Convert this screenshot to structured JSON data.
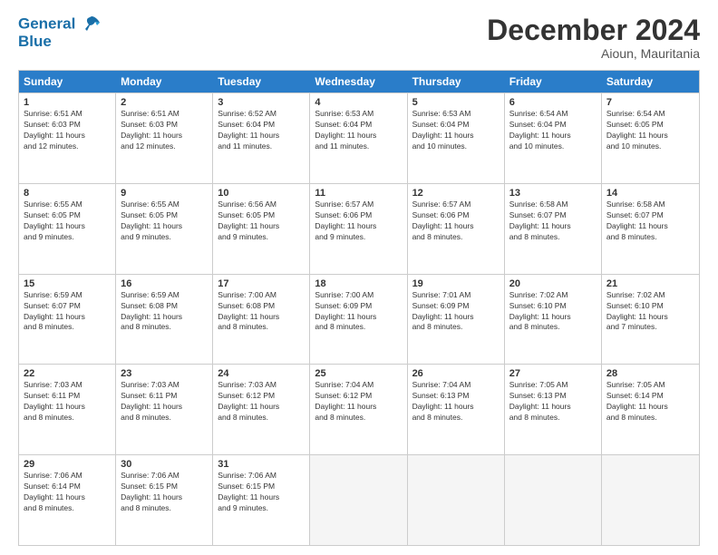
{
  "header": {
    "logo_line1": "General",
    "logo_line2": "Blue",
    "month": "December 2024",
    "location": "Aioun, Mauritania"
  },
  "weekdays": [
    "Sunday",
    "Monday",
    "Tuesday",
    "Wednesday",
    "Thursday",
    "Friday",
    "Saturday"
  ],
  "rows": [
    [
      {
        "day": "1",
        "info": "Sunrise: 6:51 AM\nSunset: 6:03 PM\nDaylight: 11 hours\nand 12 minutes."
      },
      {
        "day": "2",
        "info": "Sunrise: 6:51 AM\nSunset: 6:03 PM\nDaylight: 11 hours\nand 12 minutes."
      },
      {
        "day": "3",
        "info": "Sunrise: 6:52 AM\nSunset: 6:04 PM\nDaylight: 11 hours\nand 11 minutes."
      },
      {
        "day": "4",
        "info": "Sunrise: 6:53 AM\nSunset: 6:04 PM\nDaylight: 11 hours\nand 11 minutes."
      },
      {
        "day": "5",
        "info": "Sunrise: 6:53 AM\nSunset: 6:04 PM\nDaylight: 11 hours\nand 10 minutes."
      },
      {
        "day": "6",
        "info": "Sunrise: 6:54 AM\nSunset: 6:04 PM\nDaylight: 11 hours\nand 10 minutes."
      },
      {
        "day": "7",
        "info": "Sunrise: 6:54 AM\nSunset: 6:05 PM\nDaylight: 11 hours\nand 10 minutes."
      }
    ],
    [
      {
        "day": "8",
        "info": "Sunrise: 6:55 AM\nSunset: 6:05 PM\nDaylight: 11 hours\nand 9 minutes."
      },
      {
        "day": "9",
        "info": "Sunrise: 6:55 AM\nSunset: 6:05 PM\nDaylight: 11 hours\nand 9 minutes."
      },
      {
        "day": "10",
        "info": "Sunrise: 6:56 AM\nSunset: 6:05 PM\nDaylight: 11 hours\nand 9 minutes."
      },
      {
        "day": "11",
        "info": "Sunrise: 6:57 AM\nSunset: 6:06 PM\nDaylight: 11 hours\nand 9 minutes."
      },
      {
        "day": "12",
        "info": "Sunrise: 6:57 AM\nSunset: 6:06 PM\nDaylight: 11 hours\nand 8 minutes."
      },
      {
        "day": "13",
        "info": "Sunrise: 6:58 AM\nSunset: 6:07 PM\nDaylight: 11 hours\nand 8 minutes."
      },
      {
        "day": "14",
        "info": "Sunrise: 6:58 AM\nSunset: 6:07 PM\nDaylight: 11 hours\nand 8 minutes."
      }
    ],
    [
      {
        "day": "15",
        "info": "Sunrise: 6:59 AM\nSunset: 6:07 PM\nDaylight: 11 hours\nand 8 minutes."
      },
      {
        "day": "16",
        "info": "Sunrise: 6:59 AM\nSunset: 6:08 PM\nDaylight: 11 hours\nand 8 minutes."
      },
      {
        "day": "17",
        "info": "Sunrise: 7:00 AM\nSunset: 6:08 PM\nDaylight: 11 hours\nand 8 minutes."
      },
      {
        "day": "18",
        "info": "Sunrise: 7:00 AM\nSunset: 6:09 PM\nDaylight: 11 hours\nand 8 minutes."
      },
      {
        "day": "19",
        "info": "Sunrise: 7:01 AM\nSunset: 6:09 PM\nDaylight: 11 hours\nand 8 minutes."
      },
      {
        "day": "20",
        "info": "Sunrise: 7:02 AM\nSunset: 6:10 PM\nDaylight: 11 hours\nand 8 minutes."
      },
      {
        "day": "21",
        "info": "Sunrise: 7:02 AM\nSunset: 6:10 PM\nDaylight: 11 hours\nand 7 minutes."
      }
    ],
    [
      {
        "day": "22",
        "info": "Sunrise: 7:03 AM\nSunset: 6:11 PM\nDaylight: 11 hours\nand 8 minutes."
      },
      {
        "day": "23",
        "info": "Sunrise: 7:03 AM\nSunset: 6:11 PM\nDaylight: 11 hours\nand 8 minutes."
      },
      {
        "day": "24",
        "info": "Sunrise: 7:03 AM\nSunset: 6:12 PM\nDaylight: 11 hours\nand 8 minutes."
      },
      {
        "day": "25",
        "info": "Sunrise: 7:04 AM\nSunset: 6:12 PM\nDaylight: 11 hours\nand 8 minutes."
      },
      {
        "day": "26",
        "info": "Sunrise: 7:04 AM\nSunset: 6:13 PM\nDaylight: 11 hours\nand 8 minutes."
      },
      {
        "day": "27",
        "info": "Sunrise: 7:05 AM\nSunset: 6:13 PM\nDaylight: 11 hours\nand 8 minutes."
      },
      {
        "day": "28",
        "info": "Sunrise: 7:05 AM\nSunset: 6:14 PM\nDaylight: 11 hours\nand 8 minutes."
      }
    ],
    [
      {
        "day": "29",
        "info": "Sunrise: 7:06 AM\nSunset: 6:14 PM\nDaylight: 11 hours\nand 8 minutes."
      },
      {
        "day": "30",
        "info": "Sunrise: 7:06 AM\nSunset: 6:15 PM\nDaylight: 11 hours\nand 8 minutes."
      },
      {
        "day": "31",
        "info": "Sunrise: 7:06 AM\nSunset: 6:15 PM\nDaylight: 11 hours\nand 9 minutes."
      },
      {
        "day": "",
        "info": ""
      },
      {
        "day": "",
        "info": ""
      },
      {
        "day": "",
        "info": ""
      },
      {
        "day": "",
        "info": ""
      }
    ]
  ]
}
